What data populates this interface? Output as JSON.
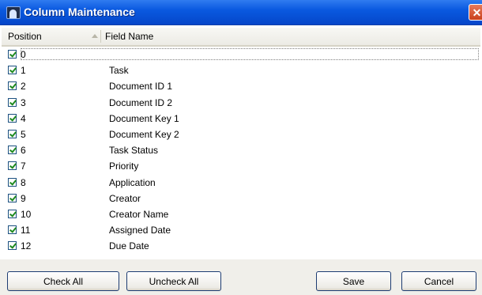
{
  "window": {
    "title": "Column Maintenance",
    "close_glyph": "✕"
  },
  "grid": {
    "columns": [
      "Position",
      "Field Name"
    ],
    "sort_icon": "sort-ascending-icon",
    "rows": [
      {
        "checked": true,
        "position": "0",
        "field": ""
      },
      {
        "checked": true,
        "position": "1",
        "field": "Task"
      },
      {
        "checked": true,
        "position": "2",
        "field": "Document ID 1"
      },
      {
        "checked": true,
        "position": "3",
        "field": "Document ID 2"
      },
      {
        "checked": true,
        "position": "4",
        "field": "Document Key 1"
      },
      {
        "checked": true,
        "position": "5",
        "field": "Document Key 2"
      },
      {
        "checked": true,
        "position": "6",
        "field": "Task Status"
      },
      {
        "checked": true,
        "position": "7",
        "field": "Priority"
      },
      {
        "checked": true,
        "position": "8",
        "field": "Application"
      },
      {
        "checked": true,
        "position": "9",
        "field": "Creator"
      },
      {
        "checked": true,
        "position": "10",
        "field": "Creator Name"
      },
      {
        "checked": true,
        "position": "11",
        "field": "Assigned Date"
      },
      {
        "checked": true,
        "position": "12",
        "field": "Due Date"
      }
    ]
  },
  "buttons": {
    "check_all": "Check All",
    "uncheck_all": "Uncheck All",
    "save": "Save",
    "cancel": "Cancel"
  },
  "colors": {
    "titlebar": "#0a59e0",
    "close": "#d9532f",
    "check": "#1e8a1e"
  }
}
